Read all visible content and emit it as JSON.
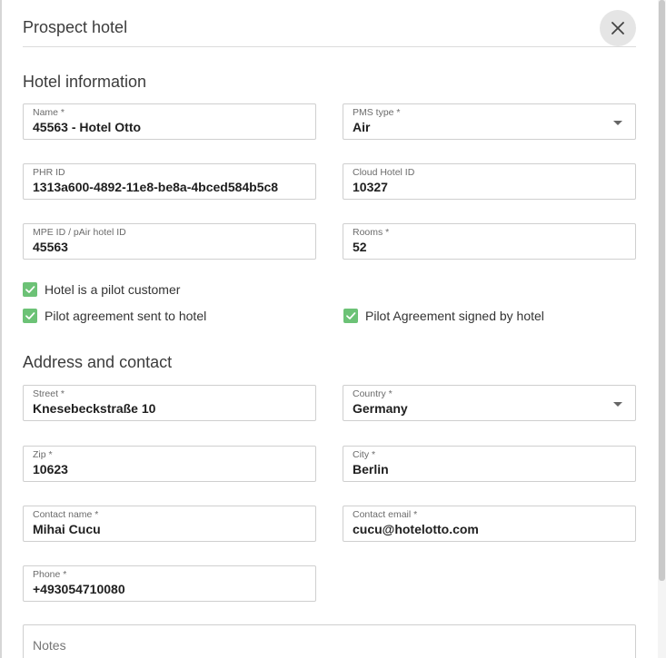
{
  "dialog": {
    "title": "Prospect hotel"
  },
  "sections": {
    "hotel_info": "Hotel information",
    "address": "Address and contact"
  },
  "fields": {
    "name": {
      "label": "Name *",
      "value": "45563 - Hotel Otto"
    },
    "pms_type": {
      "label": "PMS type *",
      "value": "Air"
    },
    "phr_id": {
      "label": "PHR ID",
      "value": "1313a600-4892-11e8-be8a-4bced584b5c8"
    },
    "cloud_hotel_id": {
      "label": "Cloud Hotel ID",
      "value": "10327"
    },
    "mpe_id": {
      "label": "MPE ID / pAir hotel ID",
      "value": "45563"
    },
    "rooms": {
      "label": "Rooms *",
      "value": "52"
    },
    "street": {
      "label": "Street *",
      "value": "Knesebeckstraße 10"
    },
    "country": {
      "label": "Country *",
      "value": "Germany"
    },
    "zip": {
      "label": "Zip *",
      "value": "10623"
    },
    "city": {
      "label": "City *",
      "value": "Berlin"
    },
    "contact_name": {
      "label": "Contact name *",
      "value": "Mihai Cucu"
    },
    "contact_email": {
      "label": "Contact email *",
      "value": "cucu@hotelotto.com"
    },
    "phone": {
      "label": "Phone *",
      "value": "+493054710080"
    },
    "notes": {
      "placeholder": "Notes"
    }
  },
  "checkboxes": {
    "pilot_customer": {
      "label": "Hotel is a pilot customer",
      "checked": true
    },
    "agreement_sent": {
      "label": "Pilot agreement sent to hotel",
      "checked": true
    },
    "agreement_signed": {
      "label": "Pilot Agreement signed by hotel",
      "checked": true
    }
  },
  "icons": {
    "close": "close-icon",
    "check": "check-icon",
    "dropdown": "chevron-down-icon"
  },
  "colors": {
    "check_accent": "#6cc276",
    "close_bg": "#e5e5e5"
  }
}
